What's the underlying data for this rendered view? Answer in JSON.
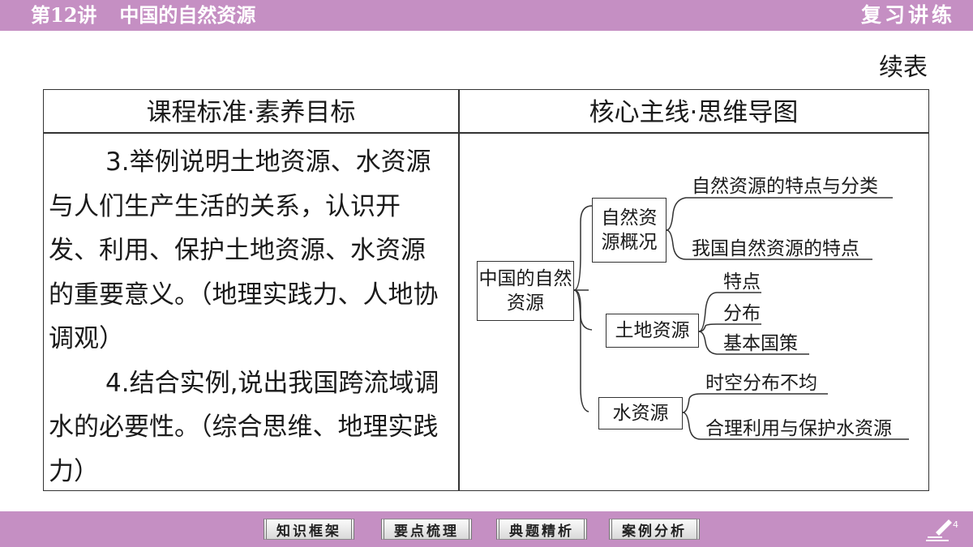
{
  "header": {
    "lecture_no": "第12讲",
    "lecture_title": "中国的自然资源",
    "section": "复习讲练"
  },
  "continued_label": "续表",
  "table": {
    "col1_header": "课程标准·素养目标",
    "col2_header": "核心主线·思维导图",
    "col1_paragraphs": [
      "3.举例说明土地资源、水资源与人们生产生活的关系，认识开发、利用、保护土地资源、水资源的重要意义。（地理实践力、人地协调观）",
      "4.结合实例,说出我国跨流域调水的必要性。（综合思维、地理实践力）"
    ]
  },
  "mindmap": {
    "root": "中国的自然资源",
    "branches": [
      {
        "label": "自然资源概况",
        "leaves": [
          "自然资源的特点与分类",
          "我国自然资源的特点"
        ]
      },
      {
        "label": "土地资源",
        "leaves": [
          "特点",
          "分布",
          "基本国策"
        ]
      },
      {
        "label": "水资源",
        "leaves": [
          "时空分布不均",
          "合理利用与保护水资源"
        ]
      }
    ]
  },
  "footer": {
    "nav": [
      "知识框架",
      "要点梳理",
      "典题精析",
      "案例分析"
    ],
    "page": "4"
  },
  "colors": {
    "bar": "#c58fc3",
    "text": "#1a1a1a"
  }
}
